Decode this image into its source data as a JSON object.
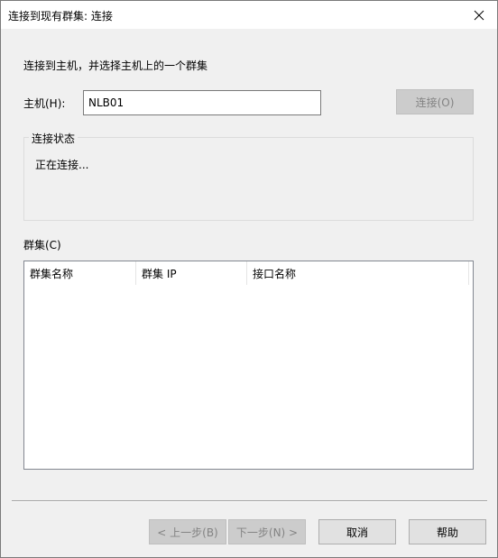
{
  "window": {
    "title": "连接到现有群集: 连接",
    "close_glyph": "✕"
  },
  "intro_text": "连接到主机，并选择主机上的一个群集",
  "host": {
    "label": "主机(H):",
    "value": "NLB01",
    "connect_label": "连接(O)"
  },
  "status_group": {
    "title": "连接状态",
    "text": "正在连接..."
  },
  "cluster": {
    "label": "群集(C)",
    "columns": [
      "群集名称",
      "群集 IP",
      "接口名称"
    ]
  },
  "footer": {
    "back_label": "< 上一步(B)",
    "next_label": "下一步(N) >",
    "cancel_label": "取消",
    "help_label": "帮助"
  },
  "colors": {
    "titlebar": "#ffffff",
    "dialog_bg": "#f0f0f0",
    "button_bg": "#e1e1e1",
    "disabled_button_bg": "#cccccc",
    "disabled_text": "#838383"
  }
}
